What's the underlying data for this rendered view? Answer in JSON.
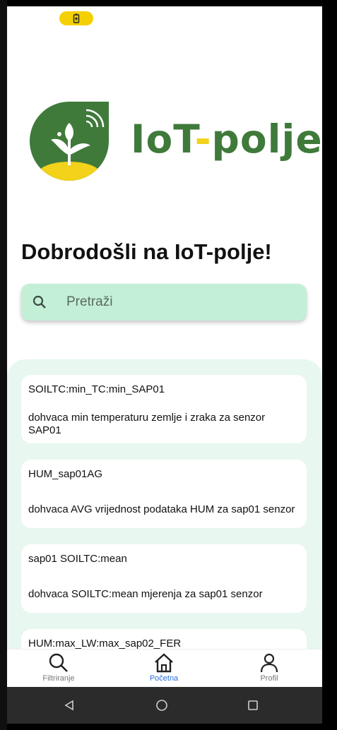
{
  "app": {
    "logo_text_a": "IoT",
    "logo_text_dash": "-",
    "logo_text_b": "polje",
    "brand_color": "#3f7a3a",
    "accent_color": "#f2d21a"
  },
  "status_bar": {
    "battery_icon": "battery-saver-icon",
    "battery_color": "#f5d000"
  },
  "page_title": "Dobrodošli na IoT-polje!",
  "search": {
    "placeholder": "Pretraži",
    "value": "",
    "icon": "search-icon"
  },
  "cards": [
    {
      "title": "SOILTC:min_TC:min_SAP01",
      "description": "dohvaca min temperaturu zemlje i zraka za senzor SAP01"
    },
    {
      "title": "HUM_sap01AG",
      "description": "dohvaca AVG vrijednost podataka HUM za sap01 senzor"
    },
    {
      "title": "sap01 SOILTC:mean",
      "description": "dohvaca SOILTC:mean mjerenja za sap01 senzor"
    },
    {
      "title": "HUM:max_LW:max_sap02_FER",
      "description": ""
    }
  ],
  "bottom_nav": {
    "items": [
      {
        "label": "Filtriranje",
        "icon": "search-icon"
      },
      {
        "label": "Početna",
        "icon": "home-icon",
        "active": true
      },
      {
        "label": "Profil",
        "icon": "user-icon"
      }
    ],
    "active_color": "#2a6ed8"
  },
  "system_nav": {
    "icons": [
      "back-icon",
      "home-circle-icon",
      "recents-icon"
    ]
  }
}
